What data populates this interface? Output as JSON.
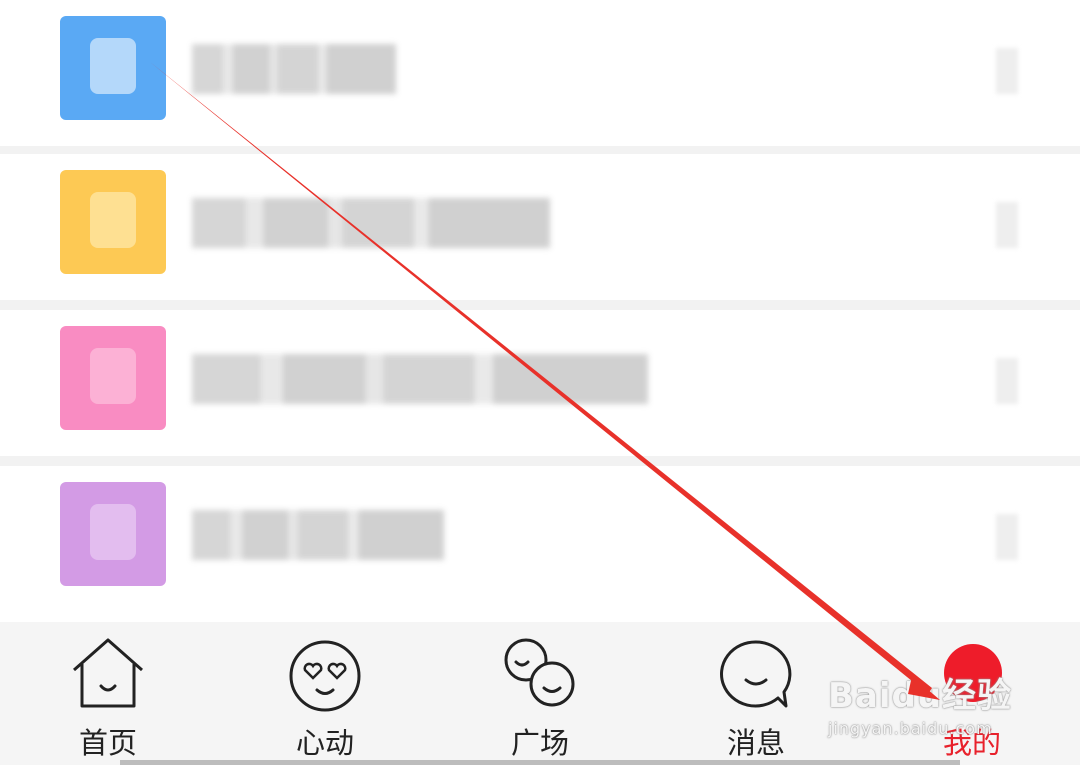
{
  "menu_items": [
    {
      "icon": "phone-icon",
      "color": "#5aa9f4"
    },
    {
      "icon": "wink-face-icon",
      "color": "#fdc954"
    },
    {
      "icon": "heart-icon",
      "color": "#f98cc2"
    },
    {
      "icon": "heart-icon",
      "color": "#d39be5"
    }
  ],
  "tabs": [
    {
      "label": "首页",
      "icon": "home-icon"
    },
    {
      "label": "心动",
      "icon": "heart-eyes-icon"
    },
    {
      "label": "广场",
      "icon": "square-icon"
    },
    {
      "label": "消息",
      "icon": "message-icon"
    },
    {
      "label": "我的",
      "icon": "profile-icon",
      "active": true
    }
  ],
  "colors": {
    "accent": "#e8212b",
    "annotation_arrow": "#e8312a"
  },
  "watermark": {
    "main": "Baidu经验",
    "sub": "jingyan.baidu.com"
  }
}
